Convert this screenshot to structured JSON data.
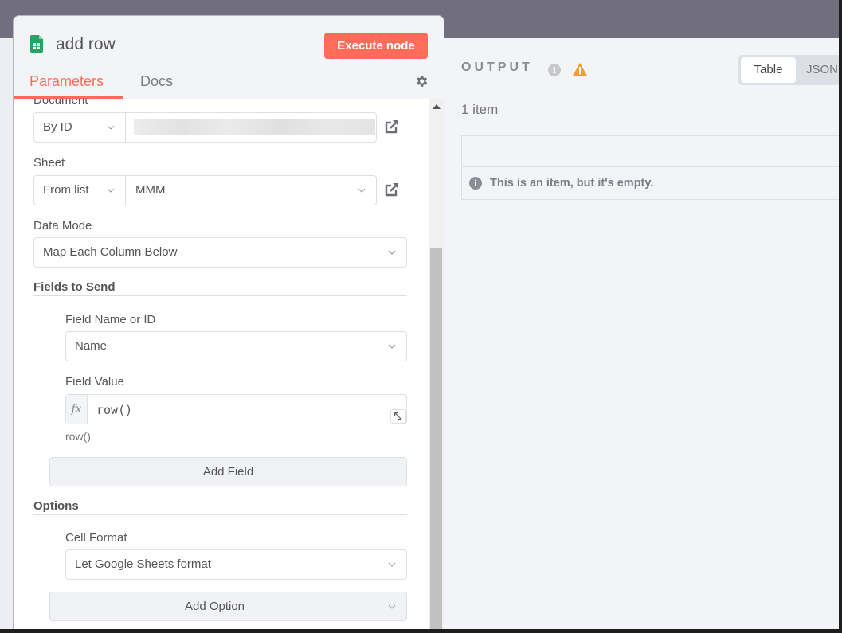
{
  "node": {
    "title": "add row",
    "icon": "google-sheets-icon",
    "execute_label": "Execute node",
    "tabs": [
      {
        "label": "Parameters",
        "active": true
      },
      {
        "label": "Docs",
        "active": false
      }
    ],
    "settings_icon": "gear-icon"
  },
  "params": {
    "document": {
      "label": "Document",
      "mode": "By ID",
      "value": "[redacted]"
    },
    "sheet": {
      "label": "Sheet",
      "mode": "From list",
      "value": "MMM"
    },
    "data_mode": {
      "label": "Data Mode",
      "value": "Map Each Column Below"
    },
    "fields_to_send": {
      "label": "Fields to Send",
      "field_name_label": "Field Name or ID",
      "field_name_value": "Name",
      "field_value_label": "Field Value",
      "field_value_prefix": "fx",
      "field_value_expression": "row()",
      "field_value_preview": "row()",
      "add_field_label": "Add Field"
    },
    "options": {
      "label": "Options",
      "cell_format_label": "Cell Format",
      "cell_format_value": "Let Google Sheets format",
      "add_option_label": "Add Option"
    }
  },
  "output": {
    "title": "OUTPUT",
    "view_tabs": [
      {
        "label": "Table",
        "active": true
      },
      {
        "label": "JSON",
        "active": false
      }
    ],
    "item_count": "1 item",
    "empty_message": "This is an item, but it's empty.",
    "info_glyph": "i"
  },
  "colors": {
    "accent": "#ff6d5a",
    "warning": "#f0a030",
    "sheets_green": "#21a464"
  }
}
